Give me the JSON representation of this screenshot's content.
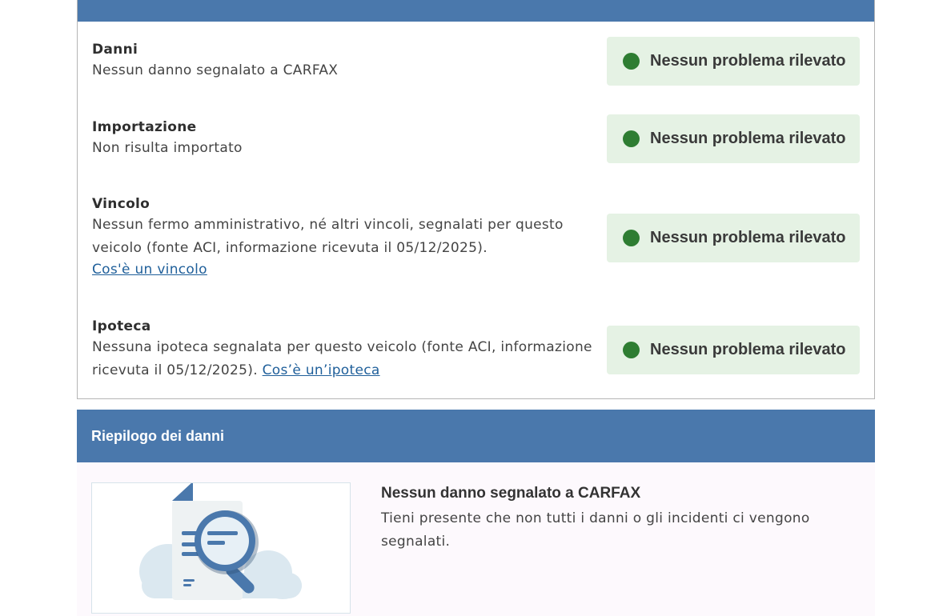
{
  "checks": [
    {
      "title": "Danni",
      "description": "Nessun danno segnalato a CARFAX",
      "link": "",
      "status": "Nessun problema rilevato"
    },
    {
      "title": "Importazione",
      "description": "Non risulta importato",
      "link": "",
      "status": "Nessun problema rilevato"
    },
    {
      "title": "Vincolo",
      "description": "Nessun fermo amministrativo, né altri vincoli, segnalati per questo veicolo (fonte ACI, informazione ricevuta il 05/12/2025).",
      "link": "Cos'è un vincolo",
      "status": "Nessun problema rilevato"
    },
    {
      "title": "Ipoteca",
      "description": "Nessuna ipoteca segnalata per questo veicolo (fonte ACI, informazione ricevuta il 05/12/2025).",
      "link": "Cos’è un’ipoteca",
      "status": "Nessun problema rilevato"
    }
  ],
  "summary": {
    "header": "Riepilogo dei danni",
    "title": "Nessun danno segnalato a CARFAX",
    "text": "Tieni presente che non tutti i danni o gli incidenti ci vengono segnalati."
  },
  "colors": {
    "accent": "#4a78ac",
    "ok_bg": "#e5f2e4",
    "ok_dot": "#2e7d32",
    "link": "#1f5f9a"
  },
  "icons": {
    "status": "green-dot-icon",
    "illustration": "document-magnifier-illustration"
  }
}
